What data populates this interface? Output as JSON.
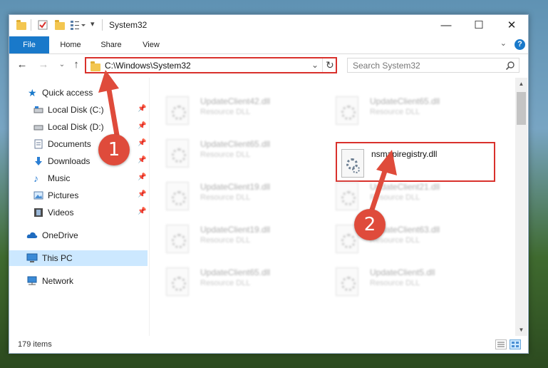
{
  "window": {
    "title": "System32",
    "controls": {
      "minimize": "—",
      "maximize": "☐",
      "close": "✕"
    }
  },
  "ribbon": {
    "tabs": [
      "File",
      "Home",
      "Share",
      "View"
    ],
    "help": "?"
  },
  "address_bar": {
    "path": "C:\\Windows\\System32",
    "search_placeholder": "Search System32"
  },
  "sidebar": {
    "items": [
      {
        "label": "Quick access",
        "icon": "star-icon",
        "pinned": false
      },
      {
        "label": "Local Disk (C:)",
        "icon": "drive-icon",
        "pinned": true
      },
      {
        "label": "Local Disk (D:)",
        "icon": "drive-icon",
        "pinned": true
      },
      {
        "label": "Documents",
        "icon": "documents-icon",
        "pinned": true
      },
      {
        "label": "Downloads",
        "icon": "download-arrow-icon",
        "pinned": true
      },
      {
        "label": "Music",
        "icon": "music-note-icon",
        "pinned": true
      },
      {
        "label": "Pictures",
        "icon": "pictures-icon",
        "pinned": true
      },
      {
        "label": "Videos",
        "icon": "film-icon",
        "pinned": true
      },
      {
        "label": "OneDrive",
        "icon": "cloud-icon",
        "pinned": false
      },
      {
        "label": "This PC",
        "icon": "computer-icon",
        "selected": true
      },
      {
        "label": "Network",
        "icon": "network-icon",
        "pinned": false
      }
    ]
  },
  "files": [
    {
      "name": "UpdateClient42.dll",
      "type": "Resource DLL"
    },
    {
      "name": "UpdateClient65.dll",
      "type": "Resource DLL"
    },
    {
      "name": "UpdateClient65.dll",
      "type": "Resource DLL"
    },
    {
      "name": "nsmapiregistry.dll",
      "type": "",
      "highlighted": true
    },
    {
      "name": "UpdateClient19.dll",
      "type": "Resource DLL"
    },
    {
      "name": "UpdateClient21.dll",
      "type": "Resource DLL"
    },
    {
      "name": "UpdateClient19.dll",
      "type": "Resource DLL"
    },
    {
      "name": "UpdateClient63.dll",
      "type": "Resource DLL"
    },
    {
      "name": "UpdateClient65.dll",
      "type": "Resource DLL"
    },
    {
      "name": "UpdateClient5.dll",
      "type": "Resource DLL"
    }
  ],
  "status": {
    "item_count": "179 items"
  },
  "annotations": {
    "step1": "1",
    "step2": "2"
  },
  "colors": {
    "accent": "#1979ca",
    "highlight_border": "#d9312c",
    "badge": "#df4b3b",
    "selected": "#cce8ff"
  }
}
